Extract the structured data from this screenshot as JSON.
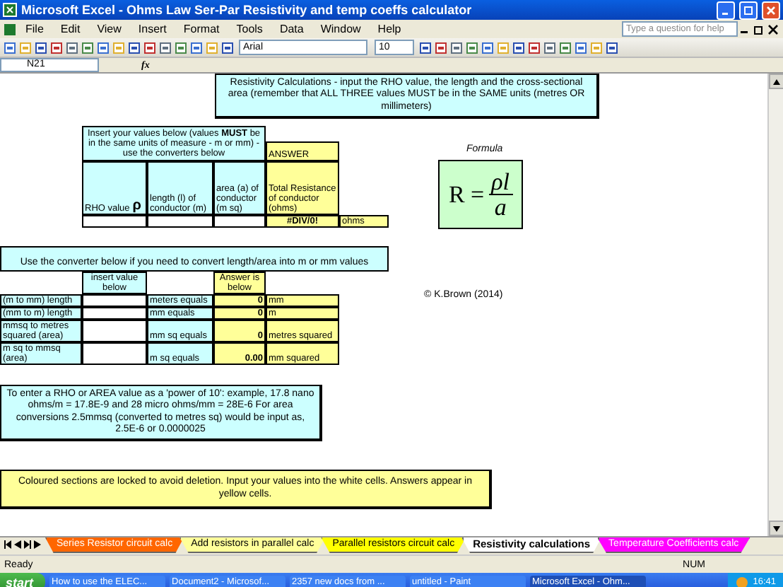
{
  "window": {
    "title": "Microsoft Excel - Ohms Law Ser-Par Resistivity and temp coeffs calculator"
  },
  "menu": [
    "File",
    "Edit",
    "View",
    "Insert",
    "Format",
    "Tools",
    "Data",
    "Window",
    "Help"
  ],
  "help_box": {
    "placeholder": "Type a question for help"
  },
  "toolbar": {
    "font": "Arial",
    "size": "10"
  },
  "formula_bar": {
    "name_box": "N21",
    "fx": "fx"
  },
  "banner": "Resistivity Calculations - input the RHO value, the length and the cross-sectional area (remember that ALL THREE values MUST be in the SAME units (metres OR millimeters)",
  "inputs": {
    "instructions": "Insert your values below (values **MUST** be in the same units of measure - m or mm) - use the converters below",
    "answer_label": "ANSWER",
    "rho_label": "RHO value",
    "rho_symbol": "ρ",
    "length_label": "length (l) of conductor (m)",
    "area_label": "area (a) of conductor (m sq)",
    "total_label": "Total Resistance of conductor (ohms)",
    "result": "#DIV/0!",
    "unit": "ohms"
  },
  "formula": {
    "label": "Formula",
    "lhs": "R =",
    "numerator": "ρl",
    "denominator": "a"
  },
  "converter": {
    "title": "Use the converter below if you need to convert length/area into m or mm values",
    "input_header": "insert value below",
    "answer_header": "Answer is below",
    "rows": [
      {
        "label": "(m to mm) length",
        "equals": "meters equals",
        "answer": "0",
        "unit": "mm"
      },
      {
        "label": "(mm to m) length",
        "equals": "mm equals",
        "answer": "0",
        "unit": "m"
      },
      {
        "label": "mmsq to metres squared (area)",
        "equals": "mm sq equals",
        "answer": "0",
        "unit": "metres squared"
      },
      {
        "label": "m sq to mmsq (area)",
        "equals": "m sq equals",
        "answer": "0.00",
        "unit": "mm squared"
      }
    ]
  },
  "copyright": "© K.Brown (2014)",
  "power_note": "To enter a RHO or AREA value as a 'power of 10': example, 17.8 nano ohms/m = 17.8E-9 and 28 micro ohms/mm = 28E-6       For area conversions 2.5mmsq (converted to metres sq) would be input as, 2.5E-6 or 0.0000025",
  "locked_note": "Coloured sections are locked to avoid deletion. Input your values into the white cells. Answers appear in yellow cells.",
  "sheet_tabs": [
    {
      "label": "Series Resistor circuit calc",
      "color": "#ff6600",
      "selected": false
    },
    {
      "label": "Add resistors in parallel calc",
      "color": "#ffff99",
      "selected": false
    },
    {
      "label": "Parallel resistors circuit calc",
      "color": "#ffff00",
      "selected": false
    },
    {
      "label": "Resistivity calculations",
      "color": "#ffffff",
      "selected": true
    },
    {
      "label": "Temperature Coefficients calc",
      "color": "#ff00ff",
      "selected": false
    }
  ],
  "status_bar": {
    "left": "Ready",
    "right": "NUM"
  },
  "taskbar": {
    "start": "start",
    "items": [
      {
        "label": "How to use the ELEC...",
        "selected": false
      },
      {
        "label": "Document2 - Microsof...",
        "selected": false
      },
      {
        "label": "2357 new docs from ...",
        "selected": false
      },
      {
        "label": "untitled - Paint",
        "selected": false
      },
      {
        "label": "Microsoft Excel - Ohm...",
        "selected": true
      }
    ],
    "clock": "16:41"
  }
}
